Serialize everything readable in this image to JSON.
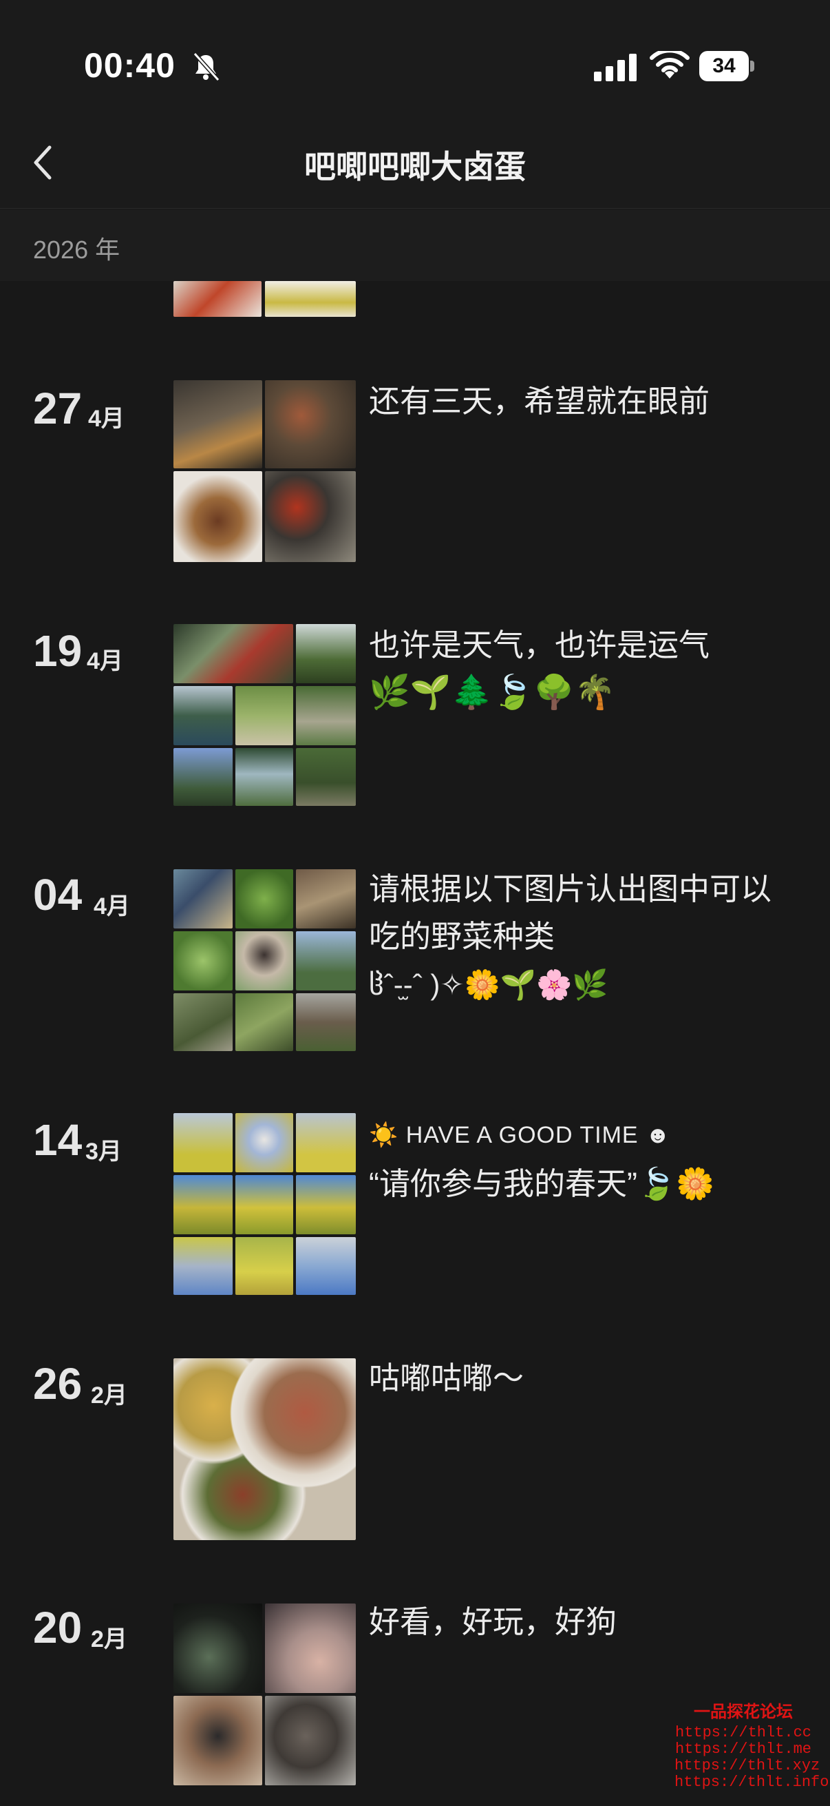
{
  "status_bar": {
    "time": "00:40",
    "battery": "34"
  },
  "nav": {
    "title": "吧唧吧唧大卤蛋"
  },
  "year_header": "2026 年",
  "entries": [
    {
      "day": "27",
      "month": "4月",
      "caption": "还有三天，希望就在眼前",
      "emoji": ""
    },
    {
      "day": "19",
      "month": "4月",
      "caption": "也许是天气，也许是运气",
      "emoji": "🌿🌱🌲🍃🌳🌴"
    },
    {
      "day": "04",
      "month": "4月",
      "caption": "请根据以下图片认出图中可以吃的野菜种类",
      "emoji": "ჱ̒ˆ-̫-ˆ )✧🌼🌱🌸🌿"
    },
    {
      "day": "14",
      "month": "3月",
      "caption_top": "☀️ HAVE A GOOD TIME ☻",
      "caption": "“请你参与我的春天”🍃🌼",
      "emoji": ""
    },
    {
      "day": "26",
      "month": "2月",
      "caption": "咕嘟咕嘟～",
      "emoji": ""
    },
    {
      "day": "20",
      "month": "2月",
      "caption": "好看，好玩，好狗",
      "emoji": ""
    }
  ],
  "watermark": {
    "title": "一品探花论坛",
    "links": [
      "https://thlt.cc",
      "https://thlt.me",
      "https://thlt.xyz",
      "https://thlt.info"
    ]
  },
  "colors": {
    "background": "#181818",
    "text": "#e8e8e8",
    "muted": "#9c9c9c",
    "watermark": "#e01414"
  }
}
